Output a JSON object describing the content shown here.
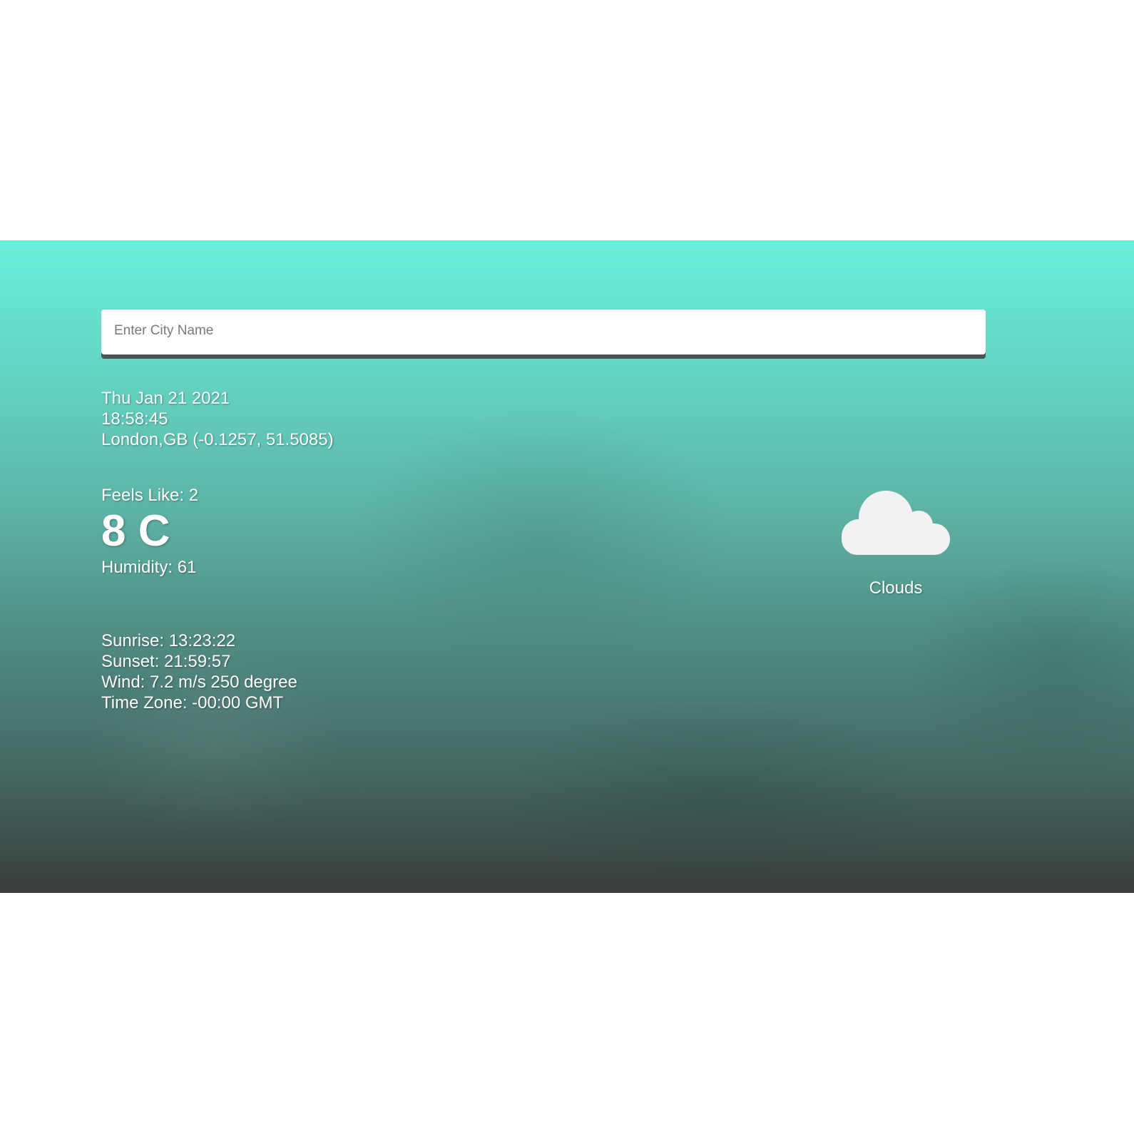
{
  "search": {
    "placeholder": "Enter City Name",
    "value": ""
  },
  "location": {
    "date": "Thu Jan 21 2021",
    "time": "18:58:45",
    "place": "London,GB (-0.1257, 51.5085)"
  },
  "current": {
    "feels_like": "Feels Like: 2",
    "temperature": "8 C",
    "humidity": "Humidity: 61"
  },
  "details": {
    "sunrise": "Sunrise: 13:23:22",
    "sunset": "Sunset: 21:59:57",
    "wind": "Wind: 7.2 m/s 250 degree",
    "timezone": "Time Zone: -00:00 GMT"
  },
  "condition": {
    "icon": "cloud-icon",
    "label": "Clouds"
  },
  "colors": {
    "gradient_top": "#6aeedb",
    "gradient_bottom": "#3a3d3c",
    "text": "#ffffff",
    "icon": "#f2f2f2"
  }
}
